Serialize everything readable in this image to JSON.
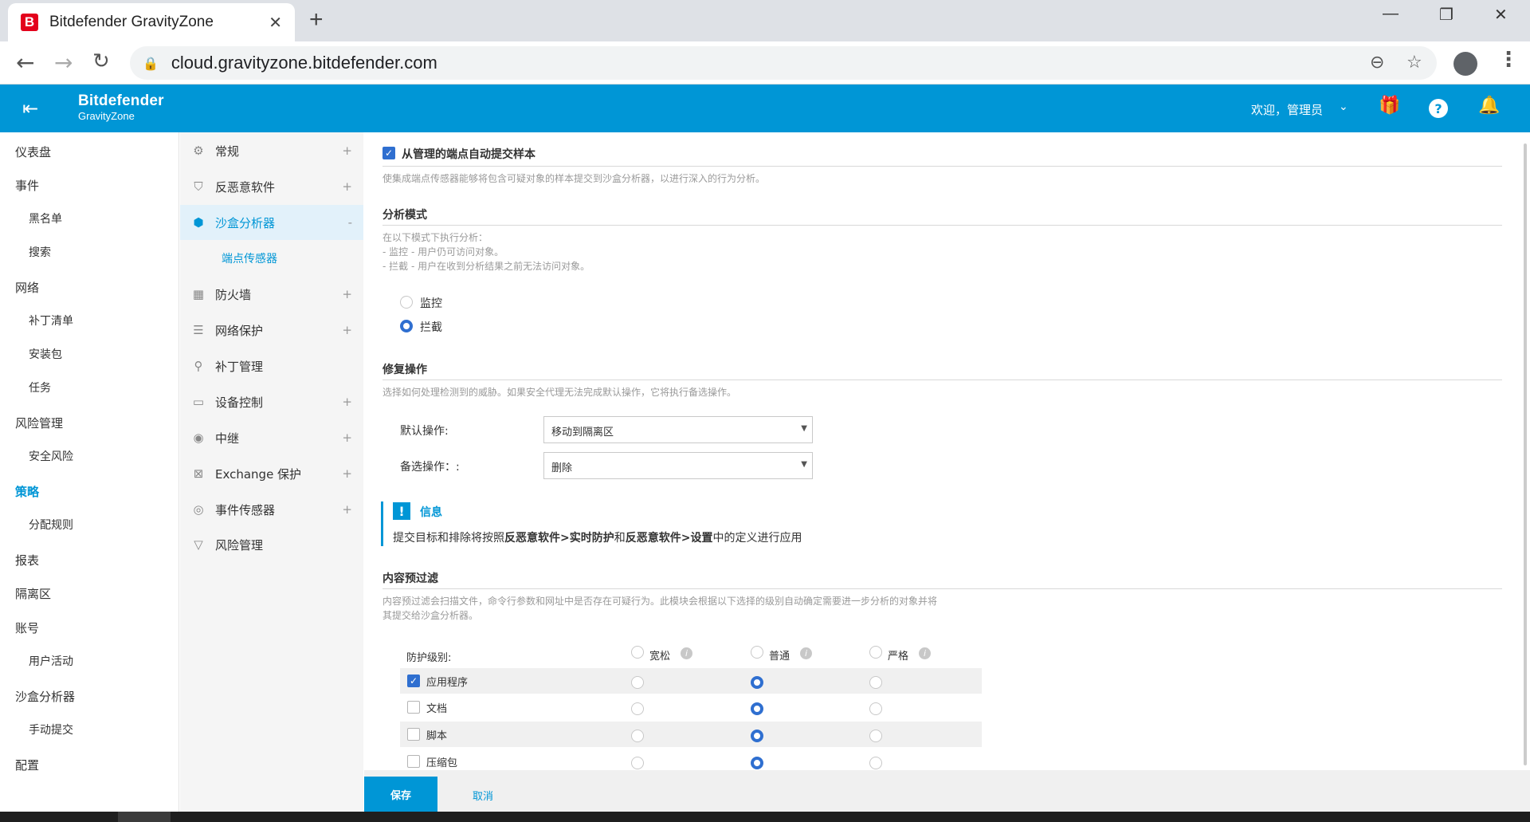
{
  "browser": {
    "tab_title": "Bitdefender GravityZone",
    "tab_favicon_letter": "B",
    "close_glyph": "✕",
    "newtab_glyph": "+",
    "url": "cloud.gravityzone.bitdefender.com"
  },
  "header": {
    "logo_main": "Bitdefender",
    "logo_sub": "GravityZone",
    "welcome": "欢迎，管理员",
    "icons": [
      "menu-collapse-icon",
      "gift-icon",
      "help-icon",
      "bell-icon"
    ]
  },
  "leftnav": {
    "items": [
      {
        "label": "仪表盘"
      },
      {
        "label": "事件"
      },
      {
        "label": "黑名单"
      },
      {
        "label": "搜索"
      },
      {
        "label": "网络"
      },
      {
        "label": "补丁清单"
      },
      {
        "label": "安装包"
      },
      {
        "label": "任务"
      },
      {
        "label": "风险管理"
      },
      {
        "label": "安全风险"
      },
      {
        "label": "策略"
      },
      {
        "label": "分配规则"
      },
      {
        "label": "报表"
      },
      {
        "label": "隔离区"
      },
      {
        "label": "账号"
      },
      {
        "label": "用户活动"
      },
      {
        "label": "沙盒分析器"
      },
      {
        "label": "手动提交"
      },
      {
        "label": "配置"
      }
    ]
  },
  "sections": {
    "items": [
      {
        "label": "常规",
        "icon": "gear-icon",
        "toggle": "+"
      },
      {
        "label": "反恶意软件",
        "icon": "shield-icon",
        "toggle": "+"
      },
      {
        "label": "沙盒分析器",
        "icon": "cube-icon",
        "toggle": "-"
      },
      {
        "label": "防火墙",
        "icon": "firewall-icon",
        "toggle": "+"
      },
      {
        "label": "网络保护",
        "icon": "database-icon",
        "toggle": "+"
      },
      {
        "label": "补丁管理",
        "icon": "bandage-icon",
        "toggle": ""
      },
      {
        "label": "设备控制",
        "icon": "monitor-icon",
        "toggle": "+"
      },
      {
        "label": "中继",
        "icon": "relay-icon",
        "toggle": "+"
      },
      {
        "label": "Exchange 保护",
        "icon": "exchange-icon",
        "toggle": "+"
      },
      {
        "label": "事件传感器",
        "icon": "sensor-icon",
        "toggle": "+"
      },
      {
        "label": "风险管理",
        "icon": "risk-icon",
        "toggle": ""
      }
    ],
    "subitem": "端点传感器"
  },
  "content": {
    "auto_submit": {
      "label": "从管理的端点自动提交样本",
      "checked": true,
      "desc": "使集成端点传感器能够将包含可疑对象的样本提交到沙盒分析器，以进行深入的行为分析。"
    },
    "analysis_mode": {
      "title": "分析模式",
      "desc1": "在以下模式下执行分析：",
      "desc2": "- 监控 - 用户仍可访问对象。",
      "desc3": "- 拦截 - 用户在收到分析结果之前无法访问对象。",
      "opt_monitor": "监控",
      "opt_block": "拦截",
      "selected": "拦截"
    },
    "remediation": {
      "title": "修复操作",
      "desc": "选择如何处理检测到的威胁。如果安全代理无法完成默认操作，它将执行备选操作。",
      "default_label": "默认操作:",
      "default_value": "移动到隔离区",
      "fallback_label": "备选操作：:",
      "fallback_value": "删除"
    },
    "info": {
      "badge": "!",
      "title": "信息",
      "t1": "提交目标和排除将按照",
      "b1": "反恶意软件>实时防护",
      "t2": "和",
      "b2": "反恶意软件>设置",
      "t3": "中的定义进行应用"
    },
    "prefilter": {
      "title": "内容预过滤",
      "desc1": "内容预过滤会扫描文件，命令行参数和网址中是否存在可疑行为。此模块会根据以下选择的级别自动确定需要进一步分析的对象并将",
      "desc2": "其提交给沙盒分析器。",
      "level_label": "防护级别:",
      "levels": [
        "宽松",
        "普通",
        "严格"
      ],
      "rows": [
        {
          "label": "应用程序",
          "checked": true,
          "level": "普通"
        },
        {
          "label": "文档",
          "checked": false,
          "level": "普通"
        },
        {
          "label": "脚本",
          "checked": false,
          "level": "普通"
        },
        {
          "label": "压缩包",
          "checked": false,
          "level": "普通"
        }
      ]
    }
  },
  "footer": {
    "save": "保存",
    "cancel": "取消"
  },
  "colors": {
    "brand": "#0096d6",
    "radio_checked": "#2f6fd0"
  }
}
